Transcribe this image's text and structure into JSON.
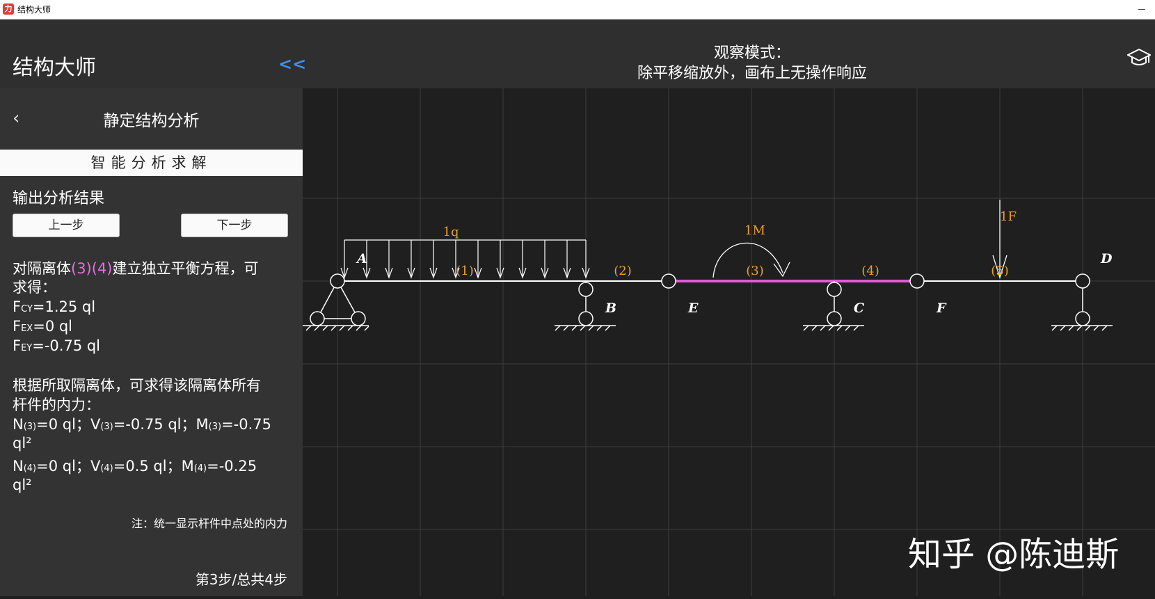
{
  "window": {
    "title": "结构大师",
    "icon_text": "力"
  },
  "header": {
    "app_title": "结构大师",
    "collapse_label": "<<",
    "mode_title": "观察模式：",
    "mode_desc": "除平移缩放外，画布上无操作响应",
    "cap_icon": "graduation-cap-icon"
  },
  "sidebar": {
    "back_icon": "‹",
    "title": "静定结构分析",
    "solve_label": "智能分析求解",
    "output_label": "输出分析结果",
    "prev_label": "上一步",
    "next_label": "下一步",
    "para1_a": "对隔离体",
    "para1_hl": "(3)(4)",
    "para1_b": "建立独立平衡方程，可",
    "para1_c": "求得：",
    "fcy_f": "F",
    "fcy_sub": "CY",
    "fcy_val": "=1.25 ql",
    "fex_f": "F",
    "fex_sub": "EX",
    "fex_val": "=0 ql",
    "fey_f": "F",
    "fey_sub": "EY",
    "fey_val": "=-0.75 ql",
    "para2_a": "根据所取隔离体，可求得该隔离体所有",
    "para2_b": "杆件的内力：",
    "r3_n": "N",
    "r3_sub": "(3)",
    "r3_nval": "=0 ql；",
    "r3_v": "V",
    "r3_vval": "=-0.75 ql；",
    "r3_m": "M",
    "r3_mval": "=-0.75",
    "r3_cont": "ql²",
    "r4_n": "N",
    "r4_sub": "(4)",
    "r4_nval": "=0 ql；",
    "r4_v": "V",
    "r4_vval": "=0.5 ql；",
    "r4_m": "M",
    "r4_mval": "=-0.25",
    "r4_cont": "ql²",
    "note": "注：统一显示杆件中点处的内力",
    "step_count": "第3步/总共4步"
  },
  "canvas": {
    "load_q": "1q",
    "load_m": "1M",
    "load_f": "1F",
    "members": [
      "(1)",
      "(2)",
      "(3)",
      "(4)",
      "(5)"
    ],
    "nodes": [
      "A",
      "B",
      "E",
      "C",
      "F",
      "D"
    ],
    "colors": {
      "grid": "#3d3d3d",
      "beam": "#ffffff",
      "highlight": "#e05ad6",
      "label": "#f0a020"
    }
  },
  "watermark": "知乎 @陈迪斯"
}
